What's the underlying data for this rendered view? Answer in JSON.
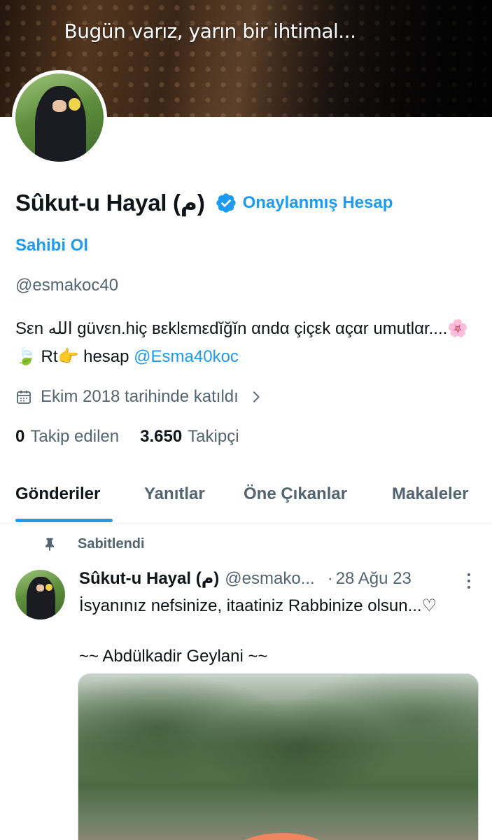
{
  "banner": {
    "caption": "Bugün varız, yarın bir ihtimal..."
  },
  "profile": {
    "display_name": "Sûkut-u Hayal (م)",
    "verified_label": "Onaylanmış Hesap",
    "owner_link": "Sahibi Ol",
    "handle": "@esmakoc40",
    "bio_text": "Sεn الله güvεn.hiç вεklεmεdĭğĭn αndα çiçεk αçαr umutlαr....🌸🍃 Rt👉 hesap ",
    "bio_mention": "@Esma40koc",
    "joined": "Ekim 2018 tarihinde katıldı",
    "following_count": "0",
    "following_label": "Takip edilen",
    "followers_count": "3.650",
    "followers_label": "Takipçi"
  },
  "tabs": [
    {
      "label": "Gönderiler",
      "active": true
    },
    {
      "label": "Yanıtlar",
      "active": false
    },
    {
      "label": "Öne Çıkanlar",
      "active": false
    },
    {
      "label": "Makaleler",
      "active": false
    }
  ],
  "pinned_tweet": {
    "pinned_label": "Sabitlendi",
    "author_name": "Sûkut-u Hayal (م)",
    "author_handle": "@esmako...",
    "dot": "·",
    "date": "28 Ağu 23",
    "text": "İsyanınız nefsinize, itaatiniz Rabbinize olsun...♡\n\n~~ Abdülkadir Geylani ~~"
  },
  "colors": {
    "accent": "#1d9bf0",
    "text_primary": "#0f1419",
    "text_secondary": "#536471"
  },
  "icons": {
    "verified": "verified-badge-icon",
    "calendar": "calendar-icon",
    "chevron": "chevron-right-icon",
    "pin": "pin-icon",
    "more": "more-vertical-icon"
  }
}
